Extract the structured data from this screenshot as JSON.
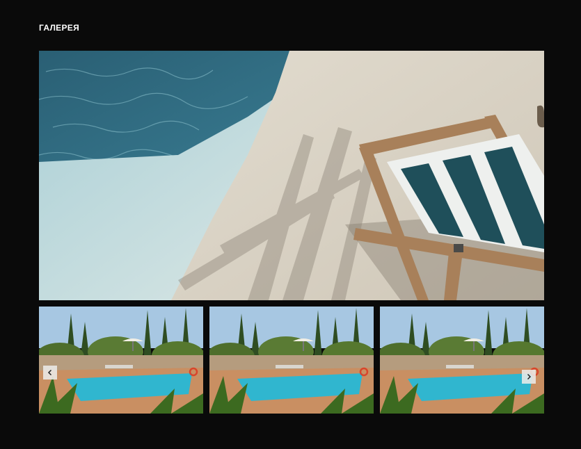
{
  "gallery": {
    "title": "ГАЛЕРЕЯ",
    "main_image": {
      "icon": "pool-deck-chair-photo",
      "description_colors": {
        "water": "#2f6f85",
        "deck": "#d8d2c6",
        "chair_stripe_dark": "#1f4f5a",
        "chair_wood": "#a8805a"
      }
    },
    "thumbnails": [
      {
        "icon": "garden-pool-photo"
      },
      {
        "icon": "garden-pool-photo"
      },
      {
        "icon": "garden-pool-photo"
      }
    ],
    "prev_icon": "chevron-left-icon",
    "next_icon": "chevron-right-icon"
  },
  "colors": {
    "background": "#0a0a0a",
    "title": "#ffffff",
    "arrow_bg": "#ebebe8"
  }
}
